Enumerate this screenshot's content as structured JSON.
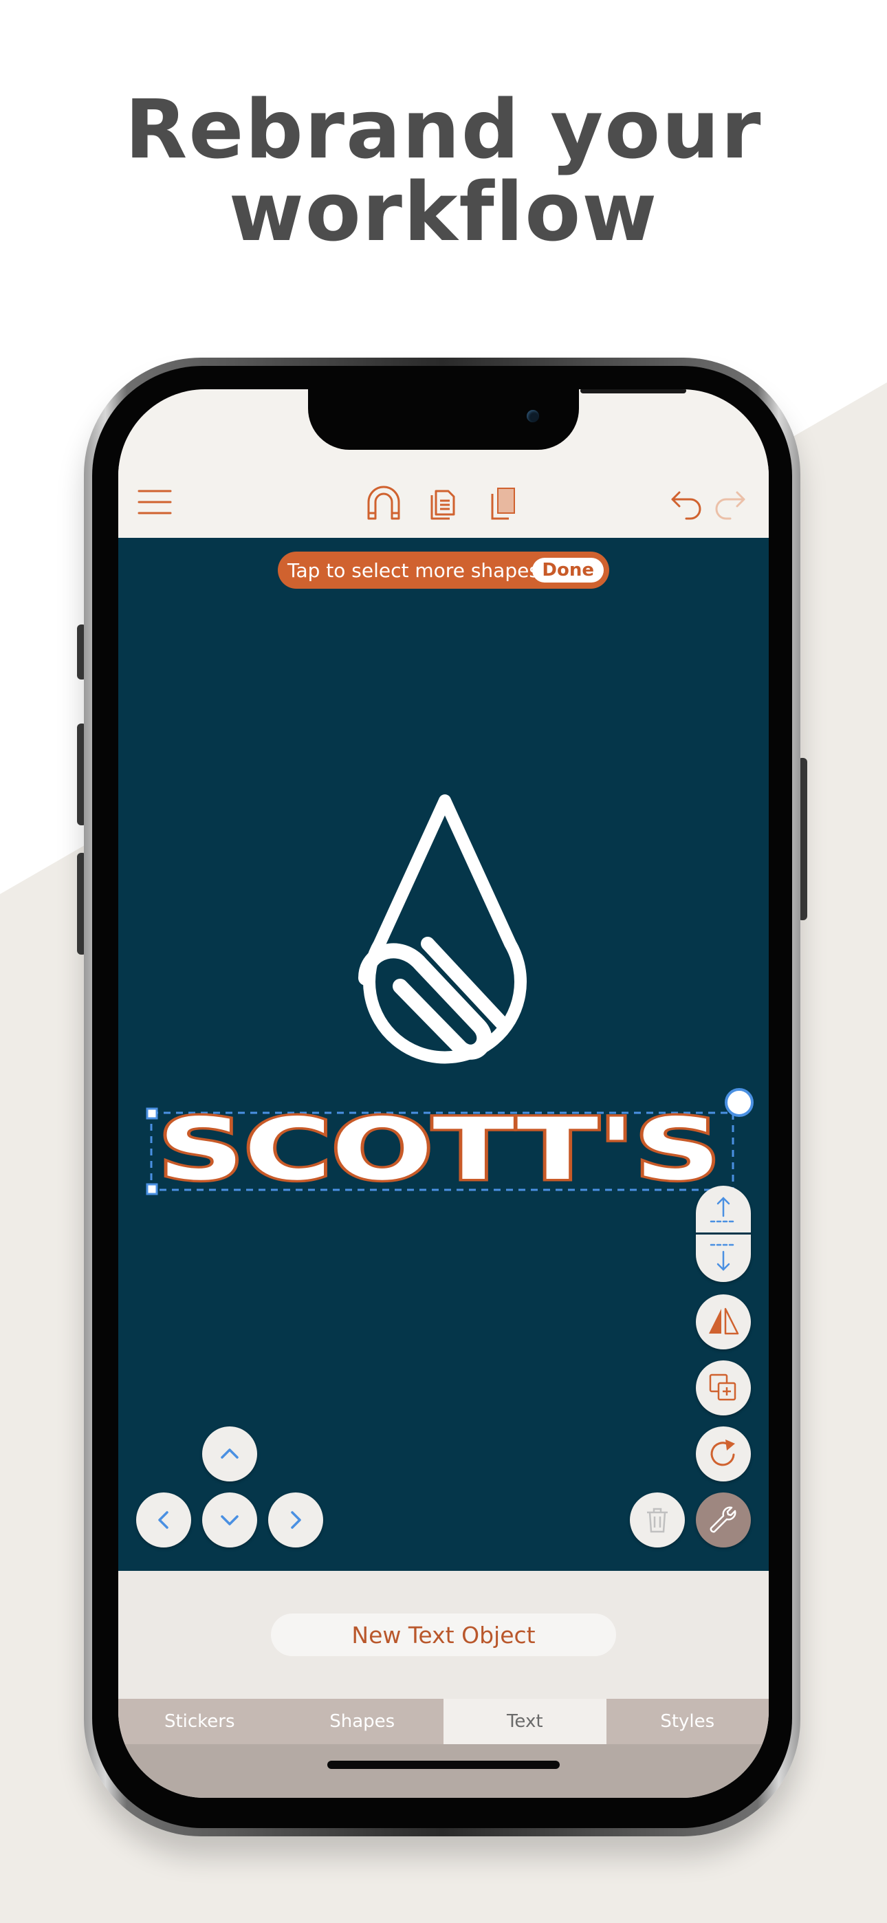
{
  "headline": {
    "line1": "Rebrand your",
    "line2": "workflow"
  },
  "colors": {
    "accent": "#d0622f",
    "canvas_bg": "#05364a",
    "selection": "#4a90e2",
    "headline": "#4d4d4d"
  },
  "toolbar": {
    "menu_icon": "hamburger-menu-icon",
    "magnet_icon": "magnet-icon",
    "copy_icon": "copy-icon",
    "paste_icon": "paste-icon",
    "undo_icon": "undo-icon",
    "redo_icon": "redo-icon"
  },
  "canvas": {
    "toast_text": "Tap to select more shapes.",
    "toast_done": "Done",
    "logo_text": "SCOTT'S",
    "logo_icon": "water-drop-s-logo-icon"
  },
  "side_tools": {
    "icons": [
      "bring-forward-icon",
      "send-backward-icon",
      "flip-icon",
      "duplicate-icon",
      "rotate-icon",
      "trash-icon",
      "wrench-icon"
    ]
  },
  "nudge": {
    "icons": [
      "arrow-up-icon",
      "arrow-left-icon",
      "arrow-down-icon",
      "arrow-right-icon"
    ]
  },
  "bottom": {
    "new_text_object": "New Text Object"
  },
  "tabs": [
    {
      "label": "Stickers",
      "active": false
    },
    {
      "label": "Shapes",
      "active": false
    },
    {
      "label": "Text",
      "active": true
    },
    {
      "label": "Styles",
      "active": false
    }
  ]
}
